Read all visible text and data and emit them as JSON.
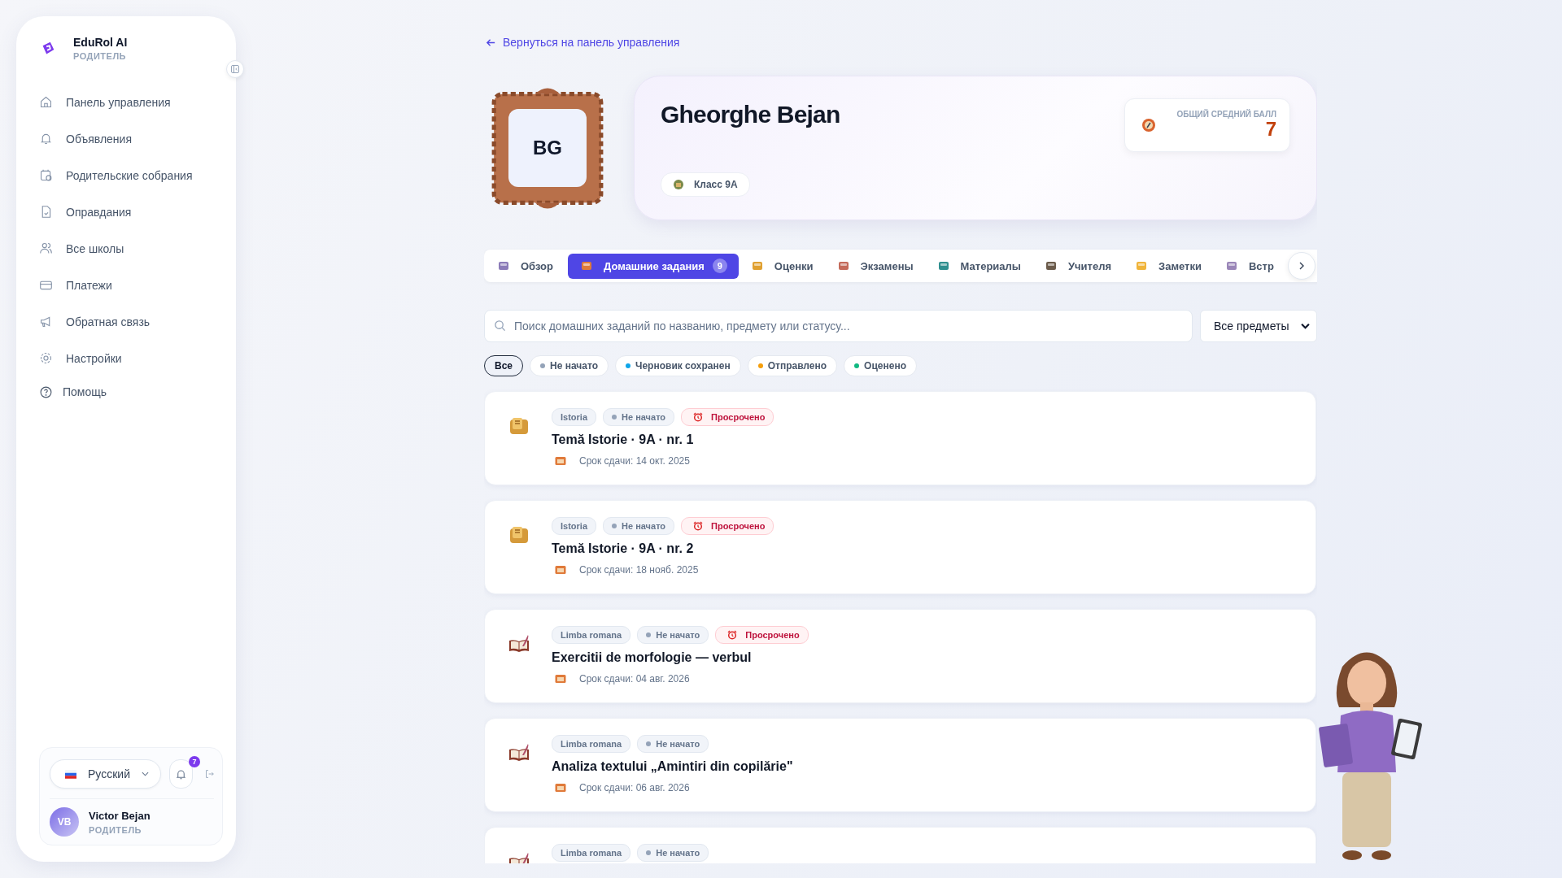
{
  "sidebar": {
    "brand": "EduRol AI",
    "role": "РОДИТЕЛЬ",
    "items": [
      {
        "label": "Панель управления"
      },
      {
        "label": "Объявления"
      },
      {
        "label": "Родительские собрания"
      },
      {
        "label": "Оправдания"
      },
      {
        "label": "Все школы"
      },
      {
        "label": "Платежи"
      },
      {
        "label": "Обратная связь"
      },
      {
        "label": "Настройки"
      },
      {
        "label": "Помощь"
      }
    ],
    "language": "Русский",
    "notifications": "7",
    "user": {
      "initials": "VB",
      "name": "Victor Bejan",
      "role": "РОДИТЕЛЬ"
    }
  },
  "back_link": "Вернуться на панель управления",
  "profile": {
    "initials": "BG",
    "name": "Gheorghe Bejan",
    "class": "Класс 9A",
    "average_label": "ОБЩИЙ СРЕДНИЙ БАЛЛ",
    "average": "7"
  },
  "tabs": [
    {
      "label": "Обзор",
      "selected": false
    },
    {
      "label": "Домашние задания",
      "count": "9",
      "selected": true
    },
    {
      "label": "Оценки",
      "selected": false
    },
    {
      "label": "Экзамены",
      "selected": false
    },
    {
      "label": "Материалы",
      "selected": false
    },
    {
      "label": "Учителя",
      "selected": false
    },
    {
      "label": "Заметки",
      "selected": false
    },
    {
      "label": "Встр",
      "selected": false
    }
  ],
  "search": {
    "placeholder": "Поиск домашних заданий по названию, предмету или статусу..."
  },
  "subject_select": "Все предметы",
  "filters": [
    {
      "label": "Все",
      "selected": true
    },
    {
      "label": "Не начато",
      "color": "#94a3b8",
      "selected": false
    },
    {
      "label": "Черновик сохранен",
      "color": "#0ea5e9",
      "selected": false
    },
    {
      "label": "Отправлено",
      "color": "#f59e0b",
      "selected": false
    },
    {
      "label": "Оценено",
      "color": "#10b981",
      "selected": false
    }
  ],
  "assignments": [
    {
      "kind": "history",
      "subject": "Istoria",
      "status": "Не начато",
      "overdue": "Просрочено",
      "title": "Temă Istorie · 9A · nr. 1",
      "due": "Срок сдачи: 14 окт. 2025"
    },
    {
      "kind": "history",
      "subject": "Istoria",
      "status": "Не начато",
      "overdue": "Просрочено",
      "title": "Temă Istorie · 9A · nr. 2",
      "due": "Срок сдачи: 18 нояб. 2025"
    },
    {
      "kind": "literature",
      "subject": "Limba romana",
      "status": "Не начато",
      "overdue": "Просрочено",
      "title": "Exercitii de morfologie — verbul",
      "due": "Срок сдачи: 04 авг. 2026"
    },
    {
      "kind": "literature",
      "subject": "Limba romana",
      "status": "Не начато",
      "title": "Analiza textului „Amintiri din copilărie\"",
      "due": "Срок сдачи: 06 авг. 2026"
    },
    {
      "kind": "literature",
      "subject": "Limba romana",
      "status": "Не начато"
    }
  ]
}
